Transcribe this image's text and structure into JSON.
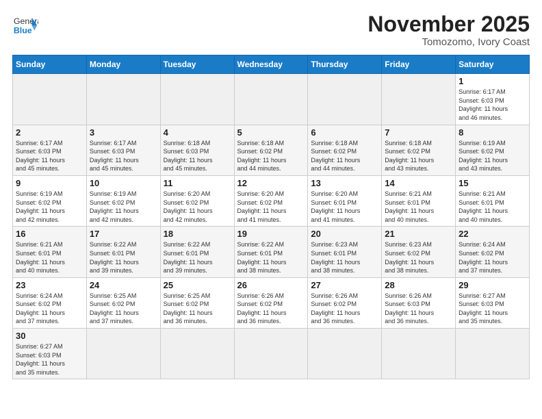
{
  "header": {
    "logo_general": "General",
    "logo_blue": "Blue",
    "month": "November 2025",
    "location": "Tomozomo, Ivory Coast"
  },
  "weekdays": [
    "Sunday",
    "Monday",
    "Tuesday",
    "Wednesday",
    "Thursday",
    "Friday",
    "Saturday"
  ],
  "weeks": [
    [
      {
        "day": "",
        "info": ""
      },
      {
        "day": "",
        "info": ""
      },
      {
        "day": "",
        "info": ""
      },
      {
        "day": "",
        "info": ""
      },
      {
        "day": "",
        "info": ""
      },
      {
        "day": "",
        "info": ""
      },
      {
        "day": "1",
        "info": "Sunrise: 6:17 AM\nSunset: 6:03 PM\nDaylight: 11 hours\nand 46 minutes."
      }
    ],
    [
      {
        "day": "2",
        "info": "Sunrise: 6:17 AM\nSunset: 6:03 PM\nDaylight: 11 hours\nand 45 minutes."
      },
      {
        "day": "3",
        "info": "Sunrise: 6:17 AM\nSunset: 6:03 PM\nDaylight: 11 hours\nand 45 minutes."
      },
      {
        "day": "4",
        "info": "Sunrise: 6:18 AM\nSunset: 6:03 PM\nDaylight: 11 hours\nand 45 minutes."
      },
      {
        "day": "5",
        "info": "Sunrise: 6:18 AM\nSunset: 6:02 PM\nDaylight: 11 hours\nand 44 minutes."
      },
      {
        "day": "6",
        "info": "Sunrise: 6:18 AM\nSunset: 6:02 PM\nDaylight: 11 hours\nand 44 minutes."
      },
      {
        "day": "7",
        "info": "Sunrise: 6:18 AM\nSunset: 6:02 PM\nDaylight: 11 hours\nand 43 minutes."
      },
      {
        "day": "8",
        "info": "Sunrise: 6:19 AM\nSunset: 6:02 PM\nDaylight: 11 hours\nand 43 minutes."
      }
    ],
    [
      {
        "day": "9",
        "info": "Sunrise: 6:19 AM\nSunset: 6:02 PM\nDaylight: 11 hours\nand 42 minutes."
      },
      {
        "day": "10",
        "info": "Sunrise: 6:19 AM\nSunset: 6:02 PM\nDaylight: 11 hours\nand 42 minutes."
      },
      {
        "day": "11",
        "info": "Sunrise: 6:20 AM\nSunset: 6:02 PM\nDaylight: 11 hours\nand 42 minutes."
      },
      {
        "day": "12",
        "info": "Sunrise: 6:20 AM\nSunset: 6:02 PM\nDaylight: 11 hours\nand 41 minutes."
      },
      {
        "day": "13",
        "info": "Sunrise: 6:20 AM\nSunset: 6:01 PM\nDaylight: 11 hours\nand 41 minutes."
      },
      {
        "day": "14",
        "info": "Sunrise: 6:21 AM\nSunset: 6:01 PM\nDaylight: 11 hours\nand 40 minutes."
      },
      {
        "day": "15",
        "info": "Sunrise: 6:21 AM\nSunset: 6:01 PM\nDaylight: 11 hours\nand 40 minutes."
      }
    ],
    [
      {
        "day": "16",
        "info": "Sunrise: 6:21 AM\nSunset: 6:01 PM\nDaylight: 11 hours\nand 40 minutes."
      },
      {
        "day": "17",
        "info": "Sunrise: 6:22 AM\nSunset: 6:01 PM\nDaylight: 11 hours\nand 39 minutes."
      },
      {
        "day": "18",
        "info": "Sunrise: 6:22 AM\nSunset: 6:01 PM\nDaylight: 11 hours\nand 39 minutes."
      },
      {
        "day": "19",
        "info": "Sunrise: 6:22 AM\nSunset: 6:01 PM\nDaylight: 11 hours\nand 38 minutes."
      },
      {
        "day": "20",
        "info": "Sunrise: 6:23 AM\nSunset: 6:01 PM\nDaylight: 11 hours\nand 38 minutes."
      },
      {
        "day": "21",
        "info": "Sunrise: 6:23 AM\nSunset: 6:02 PM\nDaylight: 11 hours\nand 38 minutes."
      },
      {
        "day": "22",
        "info": "Sunrise: 6:24 AM\nSunset: 6:02 PM\nDaylight: 11 hours\nand 37 minutes."
      }
    ],
    [
      {
        "day": "23",
        "info": "Sunrise: 6:24 AM\nSunset: 6:02 PM\nDaylight: 11 hours\nand 37 minutes."
      },
      {
        "day": "24",
        "info": "Sunrise: 6:25 AM\nSunset: 6:02 PM\nDaylight: 11 hours\nand 37 minutes."
      },
      {
        "day": "25",
        "info": "Sunrise: 6:25 AM\nSunset: 6:02 PM\nDaylight: 11 hours\nand 36 minutes."
      },
      {
        "day": "26",
        "info": "Sunrise: 6:26 AM\nSunset: 6:02 PM\nDaylight: 11 hours\nand 36 minutes."
      },
      {
        "day": "27",
        "info": "Sunrise: 6:26 AM\nSunset: 6:02 PM\nDaylight: 11 hours\nand 36 minutes."
      },
      {
        "day": "28",
        "info": "Sunrise: 6:26 AM\nSunset: 6:03 PM\nDaylight: 11 hours\nand 36 minutes."
      },
      {
        "day": "29",
        "info": "Sunrise: 6:27 AM\nSunset: 6:03 PM\nDaylight: 11 hours\nand 35 minutes."
      }
    ],
    [
      {
        "day": "30",
        "info": "Sunrise: 6:27 AM\nSunset: 6:03 PM\nDaylight: 11 hours\nand 35 minutes."
      },
      {
        "day": "",
        "info": ""
      },
      {
        "day": "",
        "info": ""
      },
      {
        "day": "",
        "info": ""
      },
      {
        "day": "",
        "info": ""
      },
      {
        "day": "",
        "info": ""
      },
      {
        "day": "",
        "info": ""
      }
    ]
  ]
}
